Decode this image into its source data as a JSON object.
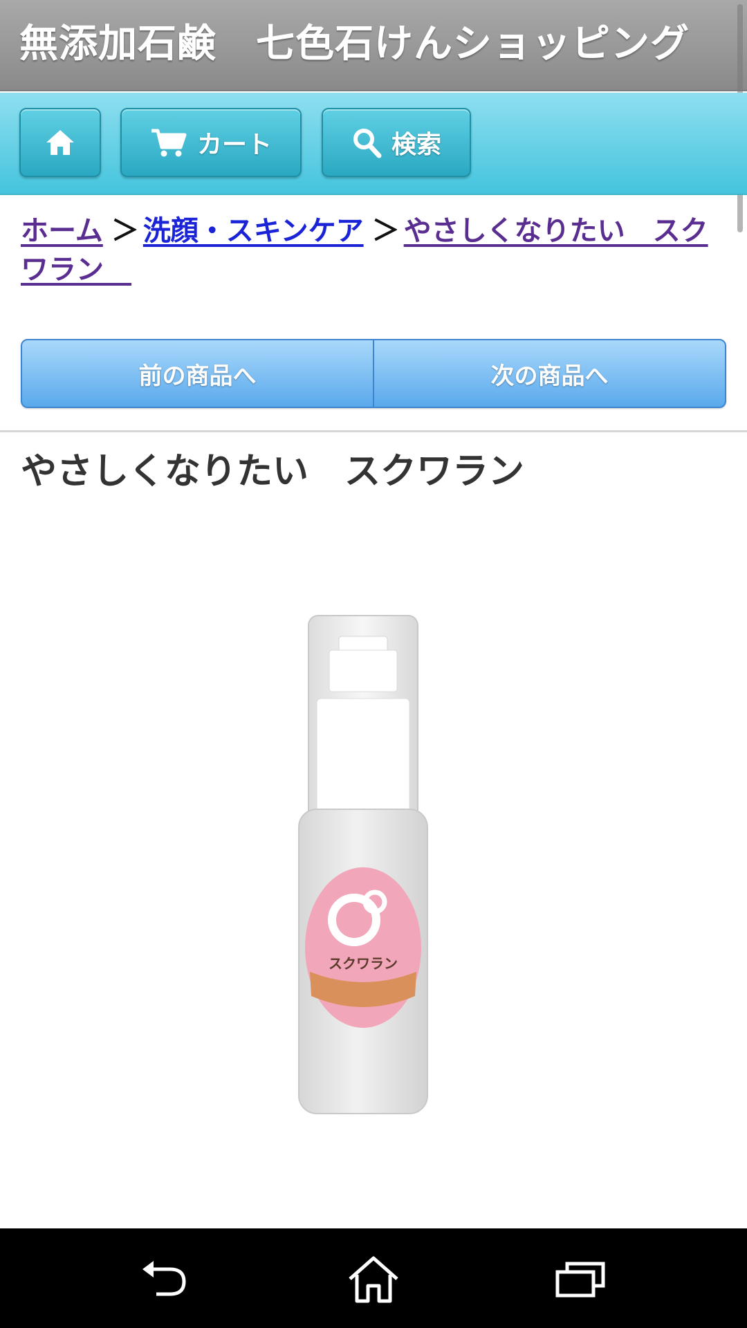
{
  "header": {
    "title": "無添加石鹸　七色石けんショッピング"
  },
  "toolbar": {
    "home_icon": "home-icon",
    "cart_label": "カート",
    "search_label": "検索"
  },
  "breadcrumb": {
    "home": "ホーム",
    "separator": "＞",
    "category": "洗顔・スキンケア",
    "current": "やさしくなりたい　スクワラン　"
  },
  "navigation": {
    "prev_label": "前の商品へ",
    "next_label": "次の商品へ"
  },
  "product": {
    "title": "やさしくなりたい　スクワラン",
    "label_name": "スクワラン"
  },
  "colors": {
    "title_bar": "#9a9a9a",
    "toolbar": "#55c8e0",
    "prevnext": "#7cbcf2",
    "label_pink": "#f2a6b9"
  },
  "system_nav": {
    "back_icon": "back-icon",
    "home_icon": "home-outline-icon",
    "recent_icon": "recent-apps-icon"
  }
}
